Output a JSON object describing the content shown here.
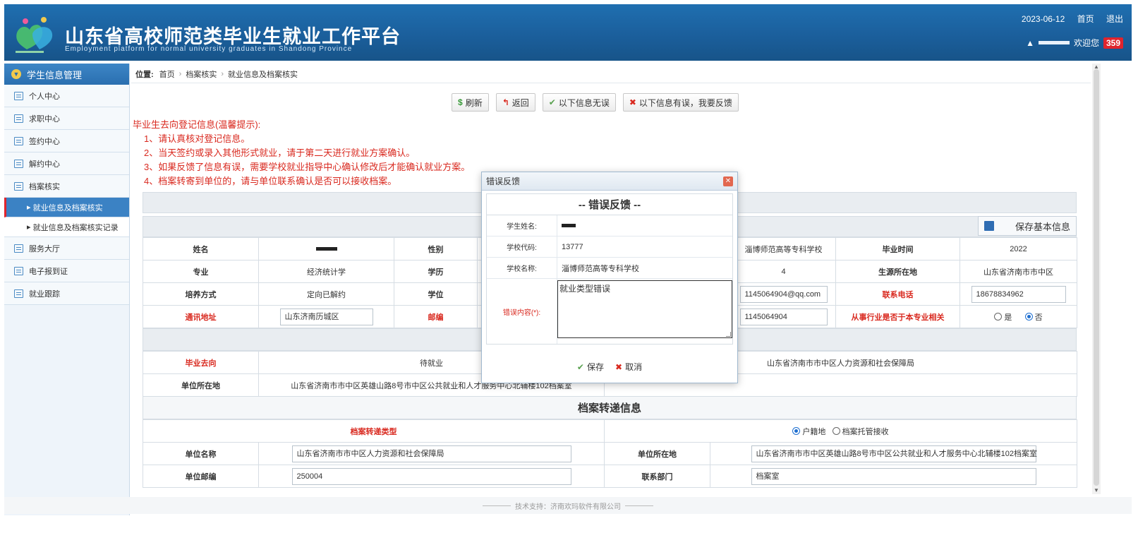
{
  "header": {
    "title": "山东省高校师范类毕业生就业工作平台",
    "subtitle": "Employment platform for normal university graduates in Shandong Province",
    "date": "2023-06-12",
    "home_link": "首页",
    "logout_link": "退出",
    "welcome": "欢迎您",
    "badge_count": "359"
  },
  "sidebar": {
    "head": "学生信息管理",
    "items": [
      {
        "label": "个人中心"
      },
      {
        "label": "求职中心"
      },
      {
        "label": "签约中心"
      },
      {
        "label": "解约中心"
      },
      {
        "label": "档案核实"
      }
    ],
    "subitems": [
      {
        "label": "就业信息及档案核实"
      },
      {
        "label": "就业信息及档案核实记录"
      }
    ],
    "items_after": [
      {
        "label": "服务大厅"
      },
      {
        "label": "电子报到证"
      },
      {
        "label": "就业跟踪"
      }
    ]
  },
  "breadcrumb": {
    "prefix": "位置:",
    "items": [
      "首页",
      "档案核实",
      "就业信息及档案核实"
    ]
  },
  "toolbar": {
    "refresh": "刷新",
    "back": "返回",
    "no_error": "以下信息无误",
    "has_error": "以下信息有误，我要反馈"
  },
  "notice": {
    "heading": "毕业生去向登记信息(温馨提示):",
    "lines": [
      "1、请认真核对登记信息。",
      "2、当天签约或录入其他形式就业，请于第二天进行就业方案确认。",
      "3、如果反馈了信息有误，需要学校就业指导中心确认修改后才能确认就业方案。",
      "4、档案转寄到单位的，请与单位联系确认是否可以接收档案。"
    ]
  },
  "basic": {
    "save_label": "保存基本信息",
    "name_label": "姓名",
    "gender_label": "性别",
    "school_value": "淄博师范高等专科学校",
    "grad_time_label": "毕业时间",
    "grad_time": "2022",
    "major_label": "专业",
    "major": "经济统计学",
    "edu_label": "学历",
    "length_value": "4",
    "origin_label": "生源所在地",
    "origin": "山东省济南市市中区",
    "train_label": "培养方式",
    "train": "定向已解约",
    "degree_label": "学位",
    "email_value": "1145064904@qq.com",
    "phone_label": "联系电话",
    "phone": "18678834962",
    "address_label": "通讯地址",
    "address": "山东济南历城区",
    "postcode_label": "邮编",
    "qq_value": "1145064904",
    "related_label": "从事行业是否于本专业相关",
    "related_yes": "是",
    "related_no": "否"
  },
  "employment": {
    "dest_label": "毕业去向",
    "dest": "待就业",
    "unit_name": "山东省济南市市中区人力资源和社会保障局",
    "unit_loc_label": "单位所在地",
    "unit_loc": "山东省济南市市中区英雄山路8号市中区公共就业和人才服务中心北辅楼102档案室"
  },
  "archive": {
    "title": "档案转递信息",
    "type_label": "档案转递类型",
    "type_opt1": "户籍地",
    "type_opt2": "档案托管接收",
    "unit_name_label": "单位名称",
    "unit_name": "山东省济南市市中区人力资源和社会保障局",
    "unit_loc_label": "单位所在地",
    "unit_loc": "山东省济南市市中区英雄山路8号市中区公共就业和人才服务中心北辅楼102档案室",
    "postcode_label": "单位邮编",
    "postcode": "250004",
    "dept_label": "联系部门",
    "dept": "档案室"
  },
  "modal": {
    "window_title": "错误反馈",
    "title": "-- 错误反馈 --",
    "student_label": "学生姓名:",
    "school_code_label": "学校代码:",
    "school_code": "13777",
    "school_name_label": "学校名称:",
    "school_name": "淄博师范高等专科学校",
    "content_label": "错误内容(*):",
    "content": "就业类型错误",
    "save": "保存",
    "cancel": "取消"
  },
  "footer": {
    "text": "技术支持：济南欢玛软件有限公司"
  },
  "colors": {
    "header_blue": "#1b5f9c",
    "notice_red": "#d9291f",
    "badge_red": "#e0242d"
  }
}
